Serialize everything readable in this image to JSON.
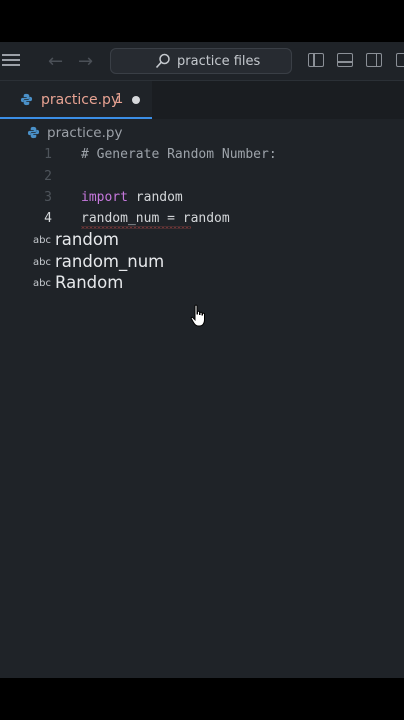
{
  "titlebar": {
    "search_label": "practice files",
    "menu_icon": "menu-icon",
    "back_icon": "arrow-left-icon",
    "forward_icon": "arrow-right-icon"
  },
  "tab": {
    "label": "practice.py",
    "badge": "1",
    "modified": true,
    "label_color": "#e8a393"
  },
  "breadcrumb": {
    "file": "practice.py"
  },
  "editor": {
    "lines": [
      {
        "number": "1",
        "code": "# Generate Random Number:"
      },
      {
        "number": "2",
        "code": ""
      },
      {
        "number": "3",
        "keyword": "import",
        "rest": " random"
      },
      {
        "number": "4",
        "code": "random_num = random"
      }
    ],
    "active_line": "4"
  },
  "suggestions": [
    {
      "kind": "abc",
      "label": "random"
    },
    {
      "kind": "abc",
      "label": "random_num"
    },
    {
      "kind": "abc",
      "label": "Random"
    }
  ],
  "colors": {
    "background": "#1f2328",
    "keyword": "#c678dd",
    "accent": "#3b8ee6",
    "error": "#d9534f"
  }
}
